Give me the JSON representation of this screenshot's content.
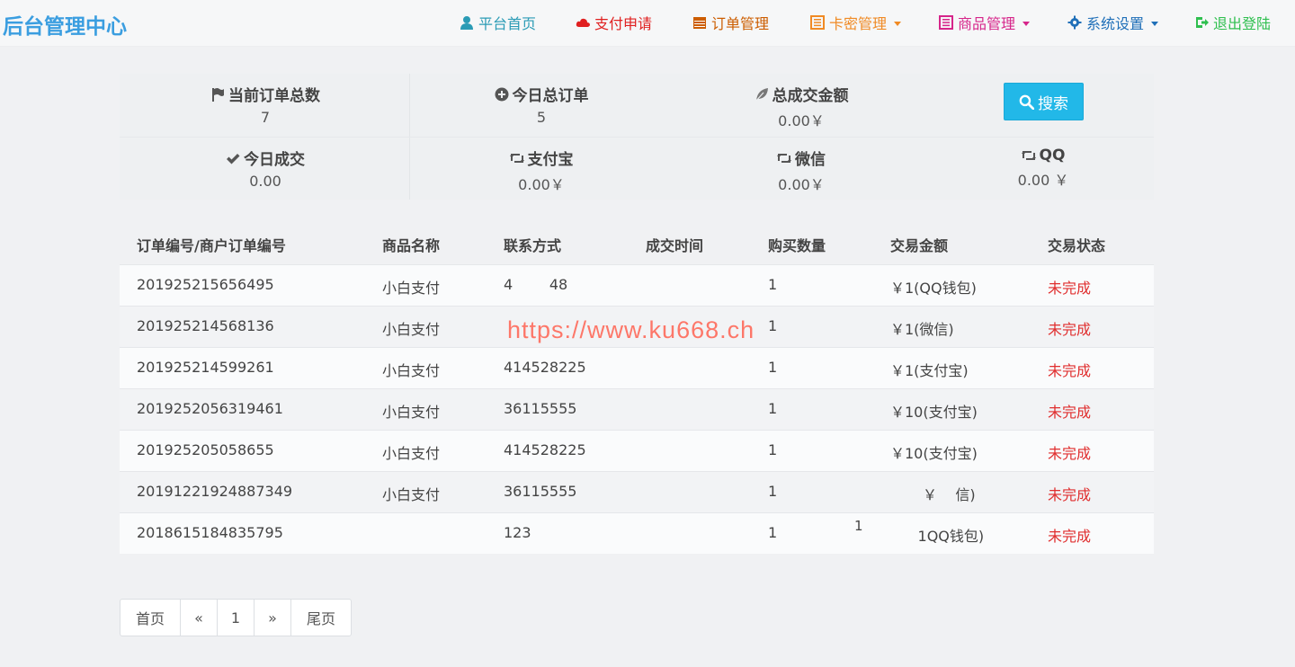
{
  "header": {
    "brand": "后台管理中心",
    "nav": [
      {
        "label": "平台首页",
        "color": "#2a9bb5",
        "icon": "user-icon",
        "dropdown": false
      },
      {
        "label": "支付申请",
        "color": "#e02020",
        "icon": "cloud-icon",
        "dropdown": false
      },
      {
        "label": "订单管理",
        "color": "#cc5d00",
        "icon": "calendar-icon",
        "dropdown": false
      },
      {
        "label": "卡密管理",
        "color": "#f08a24",
        "icon": "list-icon",
        "dropdown": true
      },
      {
        "label": "商品管理",
        "color": "#d6258a",
        "icon": "book-icon",
        "dropdown": true
      },
      {
        "label": "系统设置",
        "color": "#1f6fb8",
        "icon": "gear-icon",
        "dropdown": true
      },
      {
        "label": "退出登陆",
        "color": "#2fbf4f",
        "icon": "logout-icon",
        "dropdown": false
      }
    ]
  },
  "stats": {
    "items": [
      {
        "label": "当前订单总数",
        "value": "7",
        "icon": "flag-icon"
      },
      {
        "label": "今日总订单",
        "value": "5",
        "icon": "plus-circle-icon"
      },
      {
        "label": "总成交金额",
        "value": "0.00￥",
        "icon": "leaf-icon"
      },
      {
        "label": "今日成交",
        "value": "0.00",
        "icon": "check-icon"
      },
      {
        "label": "支付宝",
        "value": "0.00￥",
        "icon": "retweet-icon"
      },
      {
        "label": "微信",
        "value": "0.00￥",
        "icon": "retweet-icon"
      },
      {
        "label": "QQ",
        "value": "0.00 ￥",
        "icon": "retweet-icon"
      }
    ],
    "search_label": "搜索"
  },
  "table": {
    "columns": [
      "订单编号/商户订单编号",
      "商品名称",
      "联系方式",
      "成交时间",
      "购买数量",
      "交易金额",
      "交易状态"
    ],
    "rows": [
      [
        "201925215656495",
        "小白支付",
        "4        48",
        "",
        "1",
        "￥1(QQ钱包)",
        "未完成"
      ],
      [
        "201925214568136",
        "小白支付",
        "",
        "",
        "1",
        "￥1(微信)",
        "未完成"
      ],
      [
        "201925214599261",
        "小白支付",
        "414528225",
        "",
        "1",
        "￥1(支付宝)",
        "未完成"
      ],
      [
        "2019252056319461",
        "小白支付",
        "36115555",
        "",
        "1",
        "￥10(支付宝)",
        "未完成"
      ],
      [
        "201925205058655",
        "小白支付",
        "414528225",
        "",
        "1",
        "￥10(支付宝)",
        "未完成"
      ],
      [
        "20191221924887349",
        "小白支付",
        "36115555",
        "",
        "1",
        "￥    信)",
        "未完成"
      ],
      [
        "2018615184835795",
        "",
        "123",
        "",
        "1",
        "      1QQ钱包)",
        "未完成"
      ]
    ]
  },
  "overlay": {
    "watermark": "https://www.ku668.ch",
    "stray_text": "1"
  },
  "pagination": [
    "首页",
    "«",
    "1",
    "»",
    "尾页"
  ]
}
